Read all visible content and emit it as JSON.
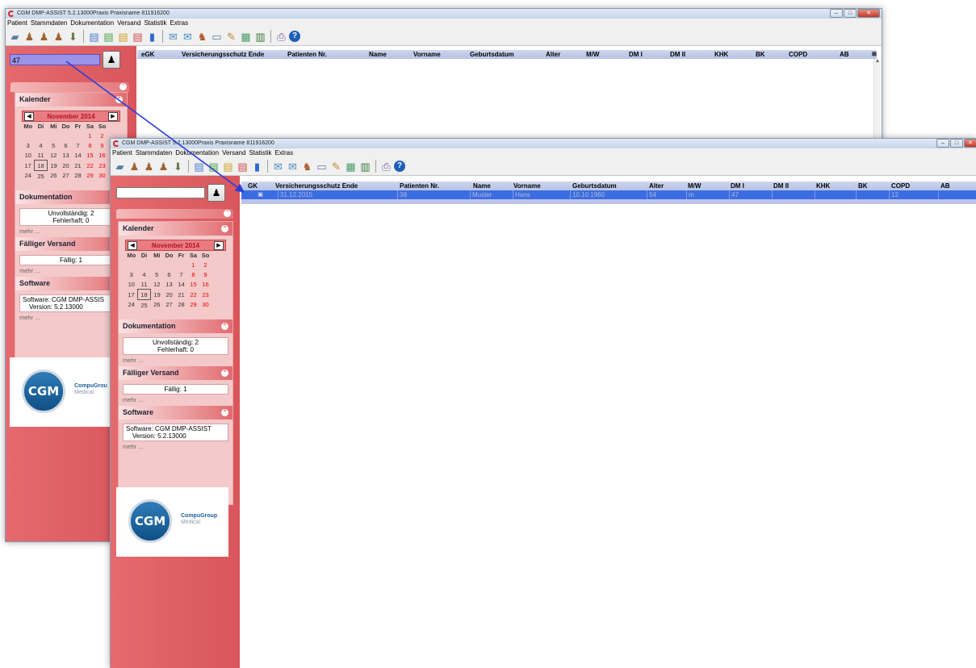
{
  "window_title": "CGM DMP-ASSIST 5.2.13000Praxis Praxisname 811916200",
  "menu": [
    "Patient",
    "Stammdaten",
    "Dokumentation",
    "Versand",
    "Statistik",
    "Extras"
  ],
  "search": {
    "back_value": "47",
    "front_value": ""
  },
  "calendar": {
    "title": "Kalender",
    "month": "November 2014",
    "weekdays": [
      "Mo",
      "Di",
      "Mi",
      "Do",
      "Fr",
      "Sa",
      "So"
    ],
    "weeks": [
      [
        "",
        "",
        "",
        "",
        "",
        "1",
        "2"
      ],
      [
        "3",
        "4",
        "5",
        "6",
        "7",
        "8",
        "9"
      ],
      [
        "10",
        "11",
        "12",
        "13",
        "14",
        "15",
        "16"
      ],
      [
        "17",
        "18",
        "19",
        "20",
        "21",
        "22",
        "23"
      ],
      [
        "24",
        "25",
        "26",
        "27",
        "28",
        "29",
        "30"
      ]
    ]
  },
  "documentation": {
    "title": "Dokumentation",
    "line1": "Unvollständig: 2",
    "line2": "Fehlerhaft: 0",
    "more": "mehr ..."
  },
  "shipping": {
    "title": "Fälliger Versand",
    "line1": "Fällig: 1",
    "more": "mehr ..."
  },
  "software": {
    "title": "Software",
    "line1": "Software: CGM DMP-ASSIST",
    "line1_back": "Software: CGM DMP-ASSIS",
    "line2": "Version: 5.2.13000",
    "more": "mehr ..."
  },
  "logo": {
    "mark": "CGM",
    "name": "CompuGroup",
    "name_back": "CompuGrou",
    "sub": "Medical"
  },
  "columns": [
    "eGK",
    "Versicherungsschutz Ende",
    "Patienten Nr.",
    "Name",
    "Vorname",
    "Geburtsdatum",
    "Alter",
    "M/W",
    "DM I",
    "DM II",
    "KHK",
    "BK",
    "COPD",
    "AB"
  ],
  "columns_front_first": "GK",
  "result_row": {
    "egk_icon": "eGK card icon",
    "insurance_end": "31.12.2015",
    "patient_no": "38",
    "name": "Muster",
    "first_name": "Hans",
    "birthdate": "10.10.1960",
    "age": "54",
    "sex": "m",
    "dm1": "47",
    "dm2": "",
    "khk": "",
    "bk": "",
    "copd": "12",
    "ab": ""
  },
  "colors": {
    "sidebar": "#e0595f",
    "selection": "#3b6de2",
    "annotation_arrow": "#2a3dd9"
  }
}
